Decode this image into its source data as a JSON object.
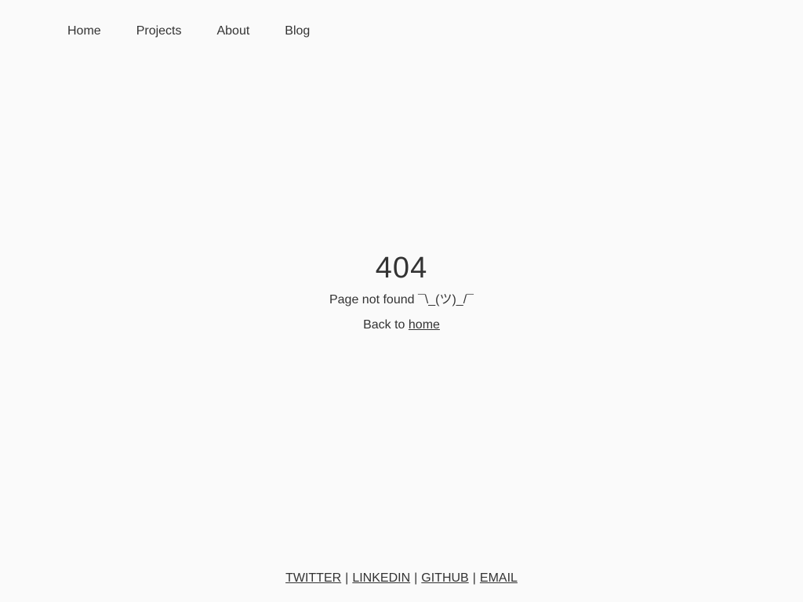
{
  "nav": {
    "items": [
      {
        "label": "Home"
      },
      {
        "label": "Projects"
      },
      {
        "label": "About"
      },
      {
        "label": "Blog"
      }
    ]
  },
  "main": {
    "code": "404",
    "message": "Page not found ¯\\_(ツ)_/¯",
    "back_prefix": "Back to",
    "back_link": "home"
  },
  "footer": {
    "links": [
      {
        "label": "TWITTER"
      },
      {
        "label": "LINKEDIN"
      },
      {
        "label": "GITHUB"
      },
      {
        "label": "EMAIL"
      }
    ],
    "separator": "|"
  },
  "colors": {
    "background": "#fafafa",
    "text": "#333333"
  }
}
